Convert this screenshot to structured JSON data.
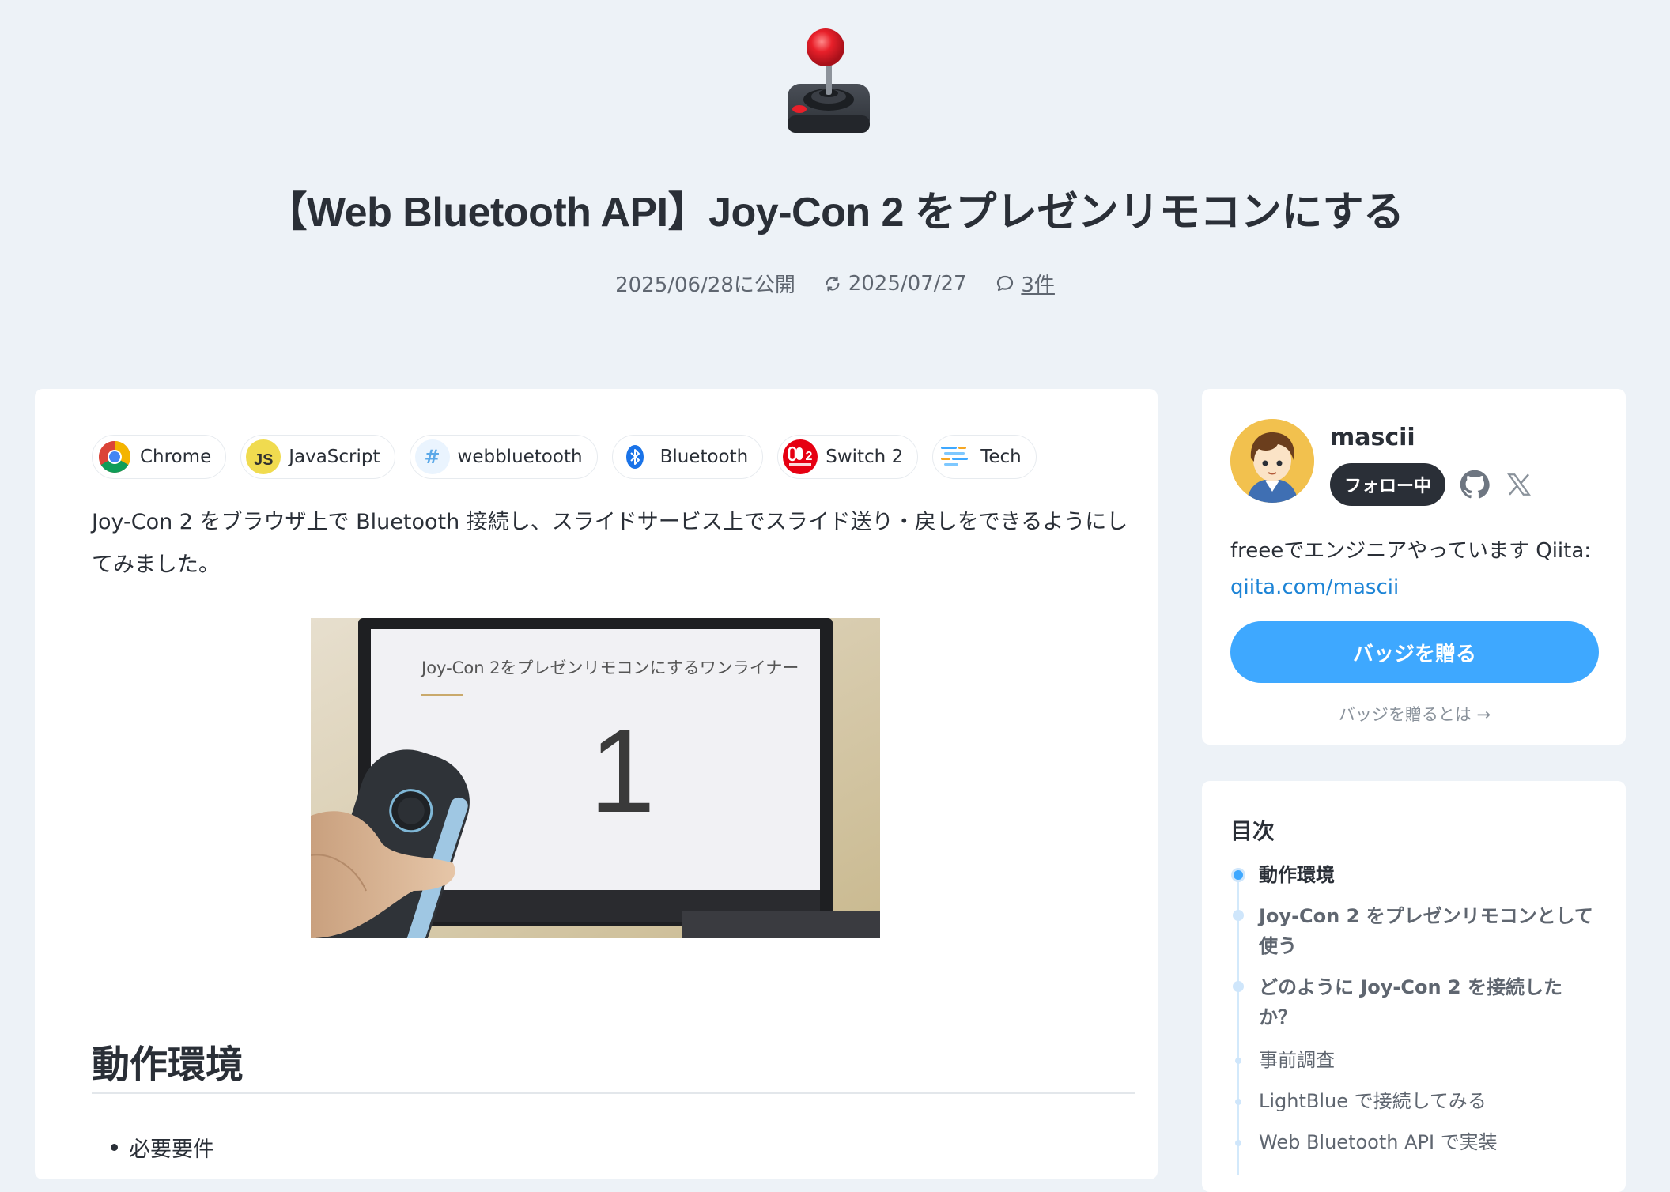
{
  "article": {
    "emoji": "joystick",
    "title": "【Web Bluetooth API】Joy-Con 2 をプレゼンリモコンにする",
    "published": "2025/06/28に公開",
    "updated": "2025/07/27",
    "comments": "3件"
  },
  "topics": [
    {
      "label": "Chrome",
      "icon": "chrome-icon"
    },
    {
      "label": "JavaScript",
      "icon": "javascript-icon"
    },
    {
      "label": "webbluetooth",
      "icon": "hash-icon"
    },
    {
      "label": "Bluetooth",
      "icon": "bluetooth-icon"
    },
    {
      "label": "Switch 2",
      "icon": "switch2-icon"
    },
    {
      "label": "Tech",
      "icon": "tech-icon"
    }
  ],
  "body": {
    "intro": "Joy-Con 2 をブラウザ上で Bluetooth 接続し、スライドサービス上でスライド送り・戻しをできるようにしてみました。",
    "hero_slide_title": "Joy-Con 2をプレゼンリモコンにするワンライナー",
    "hero_slide_number": "1",
    "section_title": "動作環境",
    "bullet_1": "必要要件"
  },
  "profile": {
    "name": "mascii",
    "follow_label": "フォロー中",
    "bio": "freeeでエンジニアやっています Qiita:",
    "bio_link": "qiita.com/mascii",
    "badge_button": "バッジを贈る",
    "badge_help": "バッジを贈るとは →"
  },
  "toc": {
    "title": "目次",
    "items": [
      {
        "label": "動作環境",
        "level": 1,
        "active": true
      },
      {
        "label": "Joy-Con 2 をプレゼンリモコンとして使う",
        "level": 1,
        "active": false
      },
      {
        "label": "どのように Joy-Con 2 を接続したか？",
        "level": 1,
        "active": false
      },
      {
        "label": "事前調査",
        "level": 2,
        "active": false
      },
      {
        "label": "LightBlue で接続してみる",
        "level": 2,
        "active": false
      },
      {
        "label": "Web Bluetooth API で実装",
        "level": 2,
        "active": false
      }
    ]
  },
  "colors": {
    "background": "#edf2f7",
    "accent": "#3ea8ff",
    "link": "#1d84d6",
    "text": "#2a2f37"
  }
}
